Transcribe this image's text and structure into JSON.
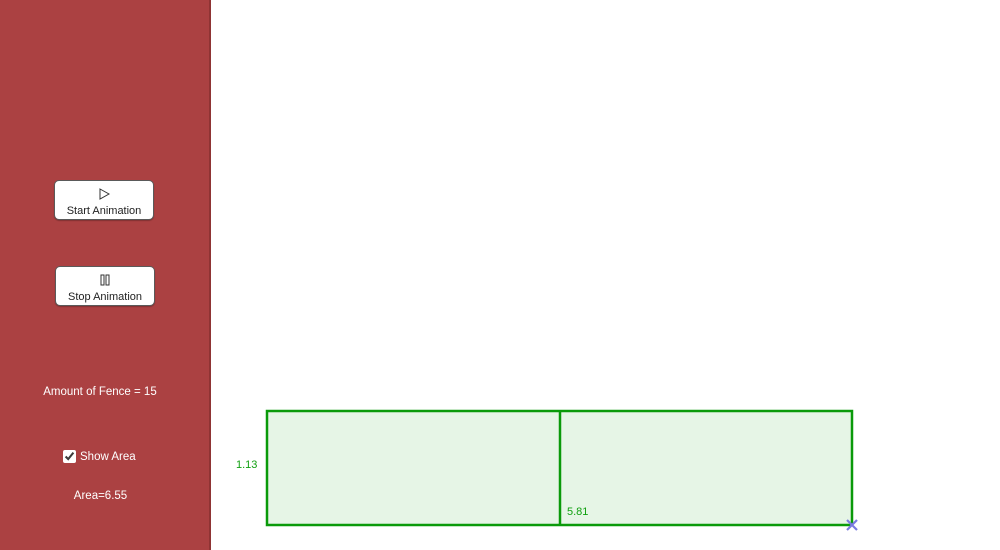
{
  "controls": {
    "start_label": "Start Animation",
    "stop_label": "Stop Animation",
    "fence_text": "Amount of Fence = 15",
    "show_area_label": "Show Area",
    "show_area_checked": true,
    "area_text": "Area=6.55"
  },
  "figure": {
    "width_label": "5.81",
    "height_label": "1.13",
    "stroke_color": "#0a9a0a",
    "fill_color": "#e6f5e6",
    "point_color": "#7b7be0"
  },
  "colors": {
    "sidebar": "#ab4142",
    "text_green": "#11a011"
  },
  "icons": {
    "start": "play-icon",
    "stop": "pause-icon"
  }
}
